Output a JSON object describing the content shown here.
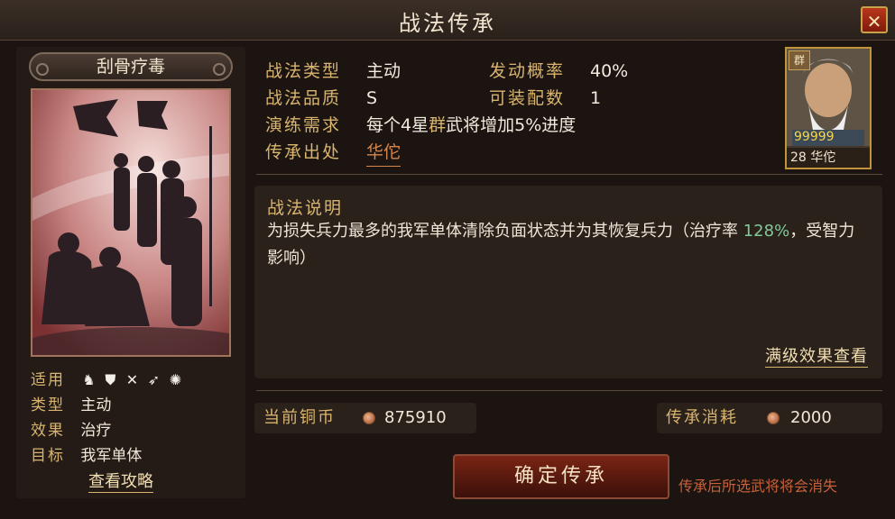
{
  "window": {
    "title": "战法传承",
    "close_icon": "close-icon"
  },
  "tactic_card": {
    "name": "刮骨疗毒",
    "rows": [
      {
        "label": "适用",
        "icons": [
          "cavalry-icon",
          "shield-icon",
          "crossbow-icon",
          "spear-icon",
          "wheel-icon"
        ]
      },
      {
        "label": "类型",
        "value": "主动"
      },
      {
        "label": "效果",
        "value": "治疗"
      },
      {
        "label": "目标",
        "value": "我军单体"
      }
    ],
    "guide_link": "查看攻略"
  },
  "info": {
    "type_label": "战法类型",
    "type_value": "主动",
    "trigger_label": "发动概率",
    "trigger_value": "40%",
    "quality_label": "战法品质",
    "quality_value": "S",
    "equip_label": "可装配数",
    "equip_value": "1",
    "train_label": "演练需求",
    "train_prefix": "每个4星",
    "train_faction": "群",
    "train_suffix": "武将增加5%进度",
    "source_label": "传承出处",
    "source_value": "华佗"
  },
  "general_card": {
    "faction_badge": "群",
    "stars": "99999",
    "level": "28",
    "name": "华佗"
  },
  "description": {
    "title": "战法说明",
    "text_part1": "为损失兵力最多的我军单体清除负面状态并为其恢复兵力（治疗率",
    "text_rate": "128%",
    "text_part2": "，受智力影响）",
    "max_effect_link": "满级效果查看"
  },
  "currency": {
    "label": "当前铜币",
    "value": "875910",
    "coin_icon": "copper-coin-icon"
  },
  "cost": {
    "label": "传承消耗",
    "value": "2000",
    "coin_icon": "copper-coin-icon"
  },
  "actions": {
    "confirm_label": "确定传承",
    "warning": "传承后所选武将将会消失"
  }
}
